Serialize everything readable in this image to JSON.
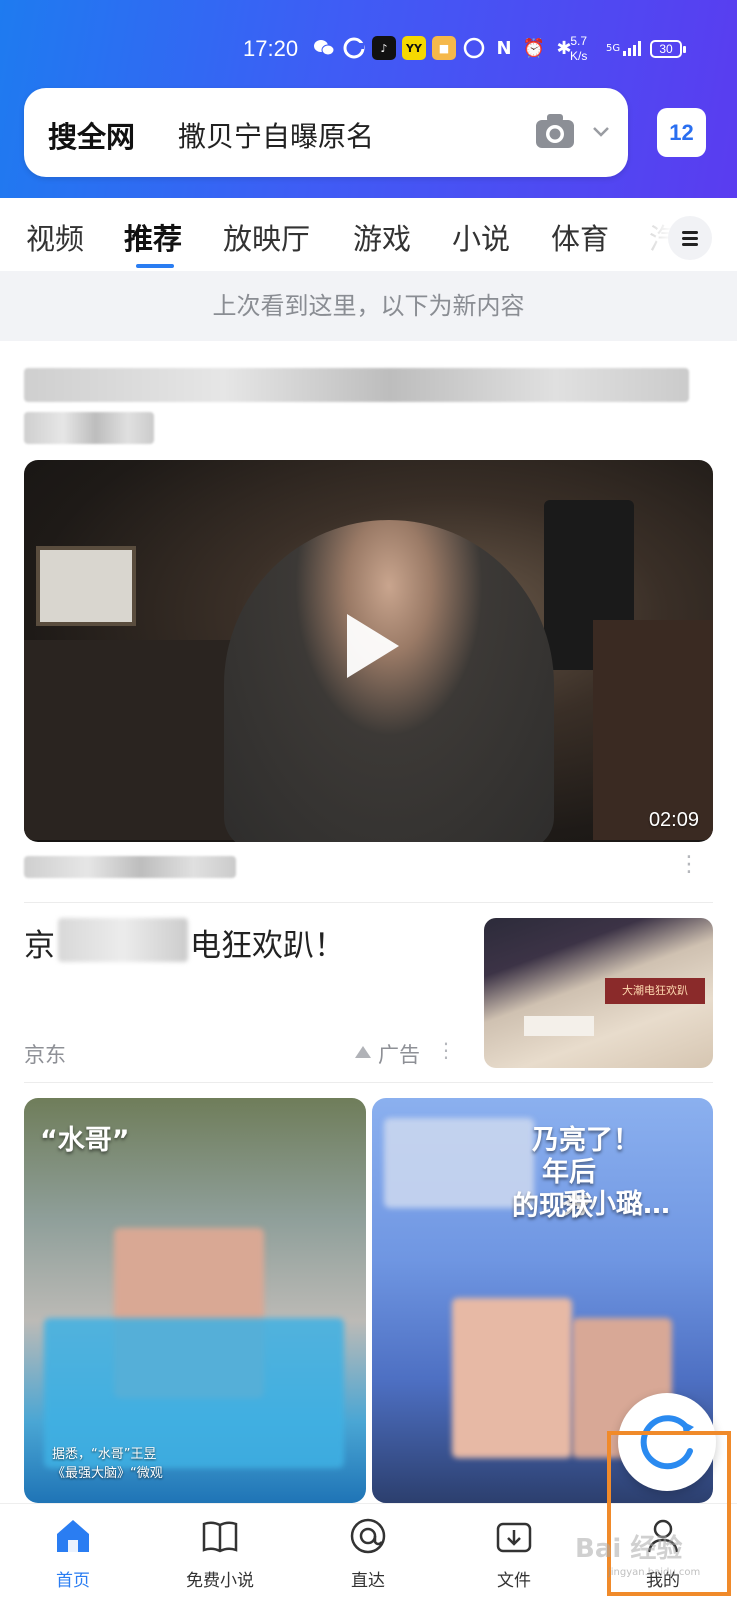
{
  "status_bar": {
    "time": "17:20",
    "net_speed_value": "5.7",
    "net_speed_unit": "K/s",
    "signal": "5G",
    "battery": "30"
  },
  "search": {
    "brand": "搜全网",
    "query": "撒贝宁自曝原名",
    "message_count": "12"
  },
  "tabs": [
    {
      "label": "视频"
    },
    {
      "label": "推荐"
    },
    {
      "label": "放映厅"
    },
    {
      "label": "游戏"
    },
    {
      "label": "小说"
    },
    {
      "label": "体育"
    },
    {
      "label": "汽"
    }
  ],
  "notice": "上次看到这里，以下为新内容",
  "feed": {
    "video_card": {
      "duration": "02:09"
    },
    "ad_card": {
      "title_start": "京",
      "title_end": "电狂欢趴！",
      "source": "京东",
      "label": "广告",
      "thumb_banner": "大潮电狂欢趴"
    },
    "grid_left": {
      "title_line1": "“水哥”",
      "caption_line1": "据悉，“水哥”王昱",
      "caption_line2": "《最强大脑》“微观"
    },
    "grid_right": {
      "title_line1": "乃亮了！",
      "title_line2": "年后",
      "title_line3": "秀小璐…",
      "title_line4": "的现状"
    }
  },
  "bottom_nav": [
    {
      "label": "首页"
    },
    {
      "label": "免费小说"
    },
    {
      "label": "直达"
    },
    {
      "label": "文件"
    },
    {
      "label": "我的"
    }
  ],
  "watermark": "Bai 经验",
  "watermark_sub": "jingyan.baidu.com",
  "colors": {
    "accent": "#2a7df2",
    "highlight": "#f08a2a"
  }
}
